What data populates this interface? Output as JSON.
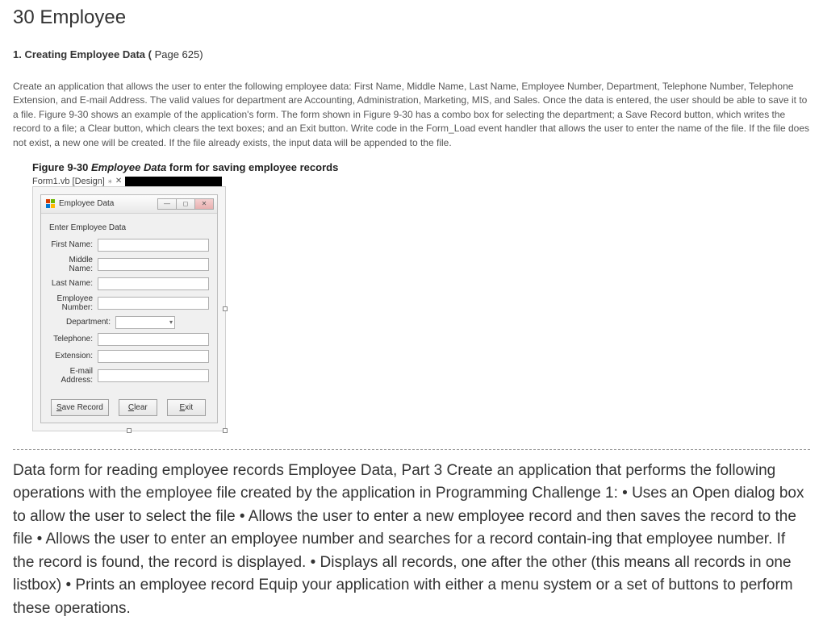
{
  "page": {
    "title": "30 Employee"
  },
  "section1": {
    "heading_num": "1.",
    "heading_bold": " Creating Employee Data (",
    "heading_rest": " Page 625)",
    "paragraph": "Create an application that allows the user to enter the following employee data: First Name, Middle Name, Last Name, Employee Number, Department, Telephone Number, Telephone Extension, and E-mail Address. The valid values for department are Accounting, Administration, Marketing, MIS, and Sales. Once the data is entered, the user should be able to save it to a file. Figure 9-30 shows an example of the application's form. The form shown in Figure 9-30 has a combo box for selecting the department; a Save Record button, which writes the record to a file; a Clear button, which clears the text boxes; and an Exit button. Write code in the Form_Load event handler that allows the user to enter the name of the file. If the file does not exist, a new one will be created. If the file already exists, the input data will be appended to the file."
  },
  "figure": {
    "caption_prefix": "Figure 9-30 ",
    "caption_italic": "Employee Data",
    "caption_rest": " form for saving employee records",
    "design_tab": "Form1.vb [Design]"
  },
  "mock": {
    "window_title": "Employee Data",
    "heading": "Enter Employee Data",
    "labels": {
      "first_name": "First Name:",
      "middle_name": "Middle Name:",
      "last_name": "Last Name:",
      "employee_number": "Employee Number:",
      "department": "Department:",
      "telephone": "Telephone:",
      "extension": "Extension:",
      "email": "E-mail Address:"
    },
    "buttons": {
      "save_prefix": "S",
      "save_rest": "ave Record",
      "clear_prefix": "C",
      "clear_rest": "lear",
      "exit_prefix": "E",
      "exit_rest": "xit"
    }
  },
  "section2": {
    "paragraph": "Data form for reading employee records Employee Data, Part 3 Create an application that performs the following operations with the employee file created by the application in Programming Challenge 1: • Uses an Open dialog box to allow the user to select the file • Allows the user to enter a new employee record and then saves the record to the file • Allows the user to enter an employee number and searches for a record contain-ing that employee number. If the record is found, the record is displayed. • Displays all records, one after the other (this means all records in one listbox) • Prints an employee record Equip your application with either a menu system or a set of buttons to perform these operations."
  }
}
